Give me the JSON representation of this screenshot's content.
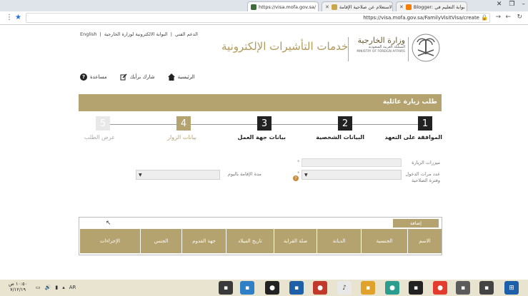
{
  "browser": {
    "tabs": [
      {
        "label": "https://visa.mofa.gov.sa/",
        "active": true
      },
      {
        "label": "الاستعلام عن صلاحية الإقامة",
        "active": false
      },
      {
        "label": "Blogger: بوابة التعليم في",
        "active": false
      }
    ],
    "url": "https://visa.mofa.gov.sa/FamilyVisitVisa/create"
  },
  "header": {
    "top_links": [
      "English",
      "الدعم الفني",
      "البوابة الالكترونية لوزارة الخارجية"
    ],
    "site_title": "خدمات التأشيرات الإلكترونية",
    "ministry_ar": "وزارة الخارجية",
    "ministry_sub": "المملكة العربية السعودية",
    "ministry_en": "MINISTRY OF FOREIGN AFFAIRS"
  },
  "quicknav": {
    "help": "مساعدة",
    "share": "شارك برأيك",
    "home": "الرئيسية"
  },
  "form": {
    "title": "طلب زيارة عائلية",
    "steps": [
      {
        "num": "1",
        "label": "الموافقة على التعهد"
      },
      {
        "num": "2",
        "label": "البيانات الشخصية"
      },
      {
        "num": "3",
        "label": "بيانات جهة العمل"
      },
      {
        "num": "4",
        "label": "بيانات الزوار"
      },
      {
        "num": "5",
        "label": "عرض الطلب"
      }
    ],
    "fields": {
      "visits_label": "ميزرات الزيارة",
      "entries_label": "عدد مرات الدخول وفترة الصلاحية",
      "duration_label": "مدة الإقامة باليوم",
      "required_mark": "*",
      "info_mark": "?"
    },
    "add_button": "إضافة",
    "columns": [
      "الاسم",
      "الجنسية",
      "الديانة",
      "صلة القرابة",
      "تاريخ الميلاد",
      "جهة القدوم",
      "الجنس",
      "الإجراءات"
    ]
  },
  "taskbar": {
    "time": "١٠:٥٠ ص",
    "date": "٧/١٢/١٩",
    "lang": "AR"
  }
}
